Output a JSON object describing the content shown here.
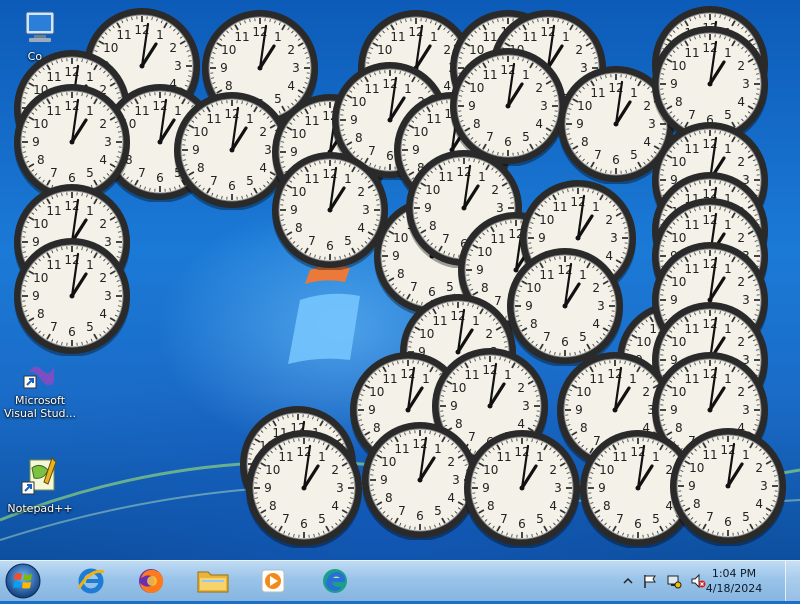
{
  "desktop": {
    "icons": [
      {
        "label": "Co...",
        "icon": "computer-icon"
      },
      {
        "label": "Microsoft Visual Stud...",
        "icon": "visual-studio-icon"
      },
      {
        "label": "Notepad++",
        "icon": "notepad-plus-plus-icon"
      }
    ],
    "clock_numbers": [
      "12",
      "1",
      "2",
      "3",
      "4",
      "5",
      "6",
      "7",
      "8",
      "9",
      "10",
      "11"
    ]
  },
  "taskbar": {
    "apps": [
      {
        "name": "internet-explorer",
        "icon": "internet-explorer-icon"
      },
      {
        "name": "firefox",
        "icon": "firefox-icon"
      },
      {
        "name": "file-explorer",
        "icon": "folder-icon"
      },
      {
        "name": "media-player",
        "icon": "media-player-icon"
      },
      {
        "name": "edge",
        "icon": "edge-icon"
      }
    ],
    "tray": {
      "time": "1:04 PM",
      "date": "4/18/2024"
    }
  },
  "colors": {
    "clock_face": "#f3f1e8",
    "clock_rim": "#2a2a2a",
    "taskbar": "#a9c9e8"
  }
}
